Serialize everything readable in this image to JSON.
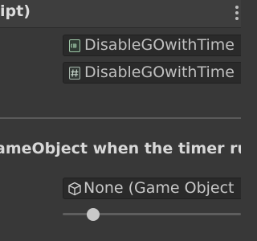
{
  "header": {
    "title": "ipt)"
  },
  "script_fields": [
    {
      "value": "DisableGOwithTime",
      "icon": "cs-script-icon"
    },
    {
      "value": "DisableGOwithTime",
      "icon": "hash-script-icon"
    }
  ],
  "section": {
    "label": "ameObject when the timer ru"
  },
  "object_field": {
    "value": "None (Game Object",
    "icon": "cube-icon"
  },
  "slider": {
    "value_fraction": 0.17
  },
  "colors": {
    "background": "#383838",
    "field_background": "#2a2a2a",
    "text": "#bfbfbf",
    "header_text": "#dcdcdc"
  }
}
